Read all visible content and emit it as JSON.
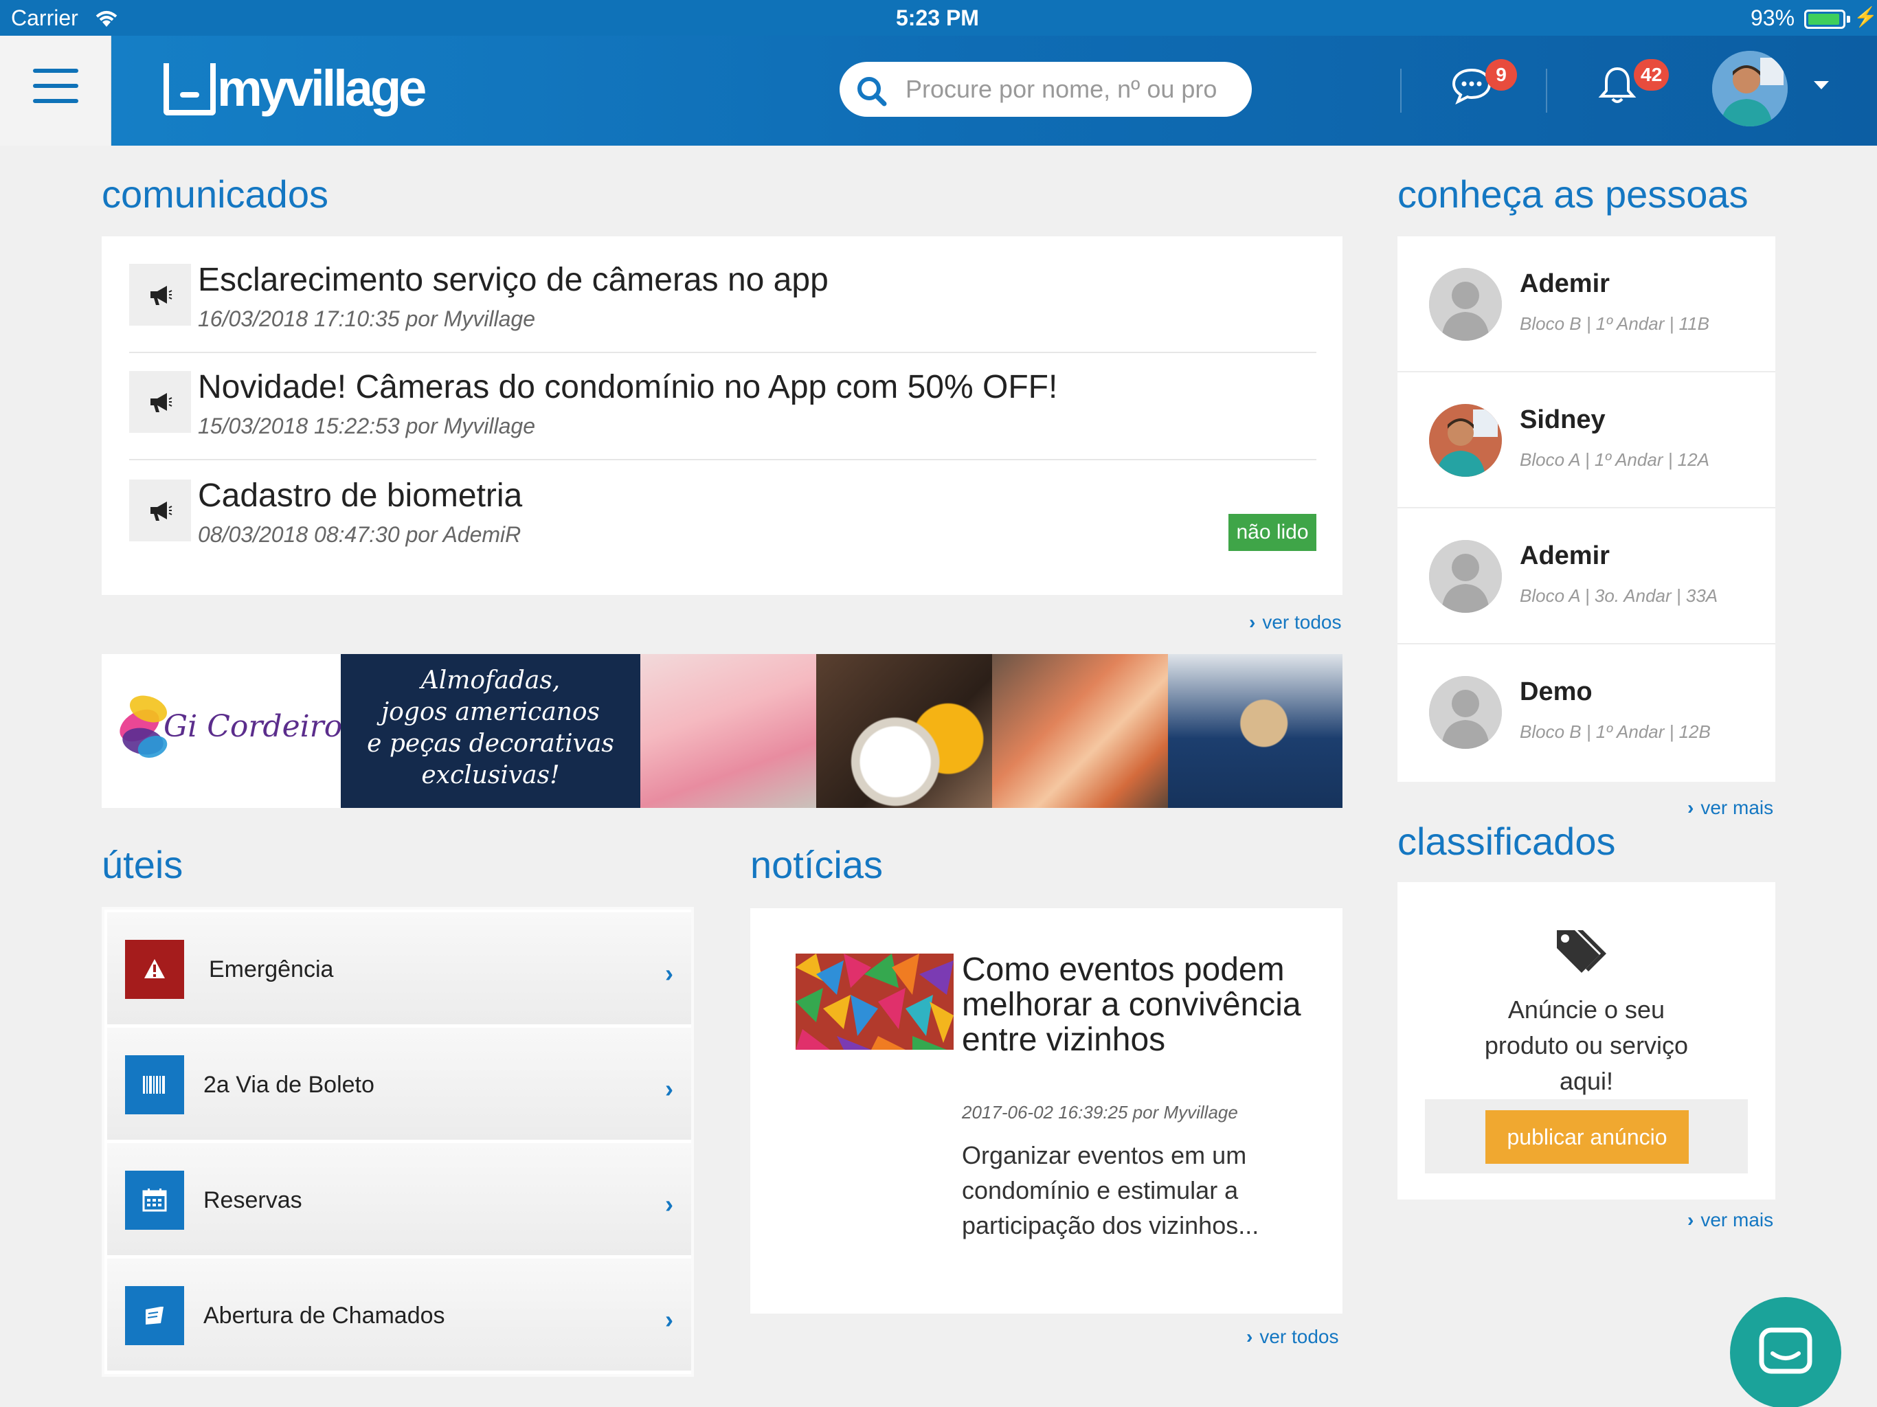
{
  "status_bar": {
    "carrier": "Carrier",
    "time": "5:23 PM",
    "battery": "93%",
    "battery_level": 0.93
  },
  "header": {
    "logo_text": "myvillage",
    "search_placeholder": "Procure por nome, nº ou pro",
    "messages_count": "9",
    "notifications_count": "42",
    "icons": [
      "menu-icon",
      "search-icon",
      "chat-icon",
      "bell-icon",
      "chevron-down-icon"
    ]
  },
  "comunicados": {
    "title": "comunicados",
    "items": [
      {
        "title": "Esclarecimento serviço de câmeras no app",
        "meta": "16/03/2018 17:10:35 por Myvillage"
      },
      {
        "title": "Novidade! Câmeras do condomínio no App com 50% OFF!",
        "meta": "15/03/2018 15:22:53 por Myvillage"
      },
      {
        "title": "Cadastro de biometria",
        "meta": "08/03/2018 08:47:30 por AdemiR",
        "badge": "não lido"
      }
    ],
    "link": "ver todos"
  },
  "banner": {
    "brand": "Gi Cordeiro",
    "text_lines": [
      "Almofadas,",
      "jogos americanos",
      "e peças decorativas",
      "exclusivas!"
    ]
  },
  "uteis": {
    "title": "úteis",
    "items": [
      {
        "label": "Emergência",
        "icon": "warning-icon",
        "color": "#a51c1c"
      },
      {
        "label": "2a Via de Boleto",
        "icon": "barcode-icon",
        "color": "#1477c2"
      },
      {
        "label": "Reservas",
        "icon": "calendar-icon",
        "color": "#1477c2"
      },
      {
        "label": "Abertura de Chamados",
        "icon": "book-icon",
        "color": "#1477c2"
      }
    ]
  },
  "noticias": {
    "title": "notícias",
    "article": {
      "title": "Como eventos podem melhorar a convivência entre vizinhos",
      "meta": "2017-06-02 16:39:25 por Myvillage",
      "excerpt": "Organizar eventos em um condomínio e estimular a participação dos vizinhos..."
    },
    "link": "ver todos"
  },
  "pessoas": {
    "title": "conheça as pessoas",
    "people": [
      {
        "name": "Ademir",
        "location": "Bloco B | 1º Andar | 11B"
      },
      {
        "name": "Sidney",
        "location": "Bloco A | 1º Andar | 12A"
      },
      {
        "name": "Ademir",
        "location": "Bloco A | 3o. Andar | 33A"
      },
      {
        "name": "Demo",
        "location": "Bloco B | 1º Andar | 12B"
      }
    ],
    "link": "ver mais"
  },
  "classificados": {
    "title": "classificados",
    "text": "Anúncie o seu produto ou serviço aqui!",
    "button": "publicar anúncio",
    "link": "ver mais"
  },
  "colors": {
    "primary": "#1477c2",
    "header": "#0f72b8",
    "unread": "#3fa548",
    "badge": "#e84c3d",
    "publish": "#f0a830",
    "chat": "#1ba39a",
    "emergency": "#a51c1c"
  }
}
